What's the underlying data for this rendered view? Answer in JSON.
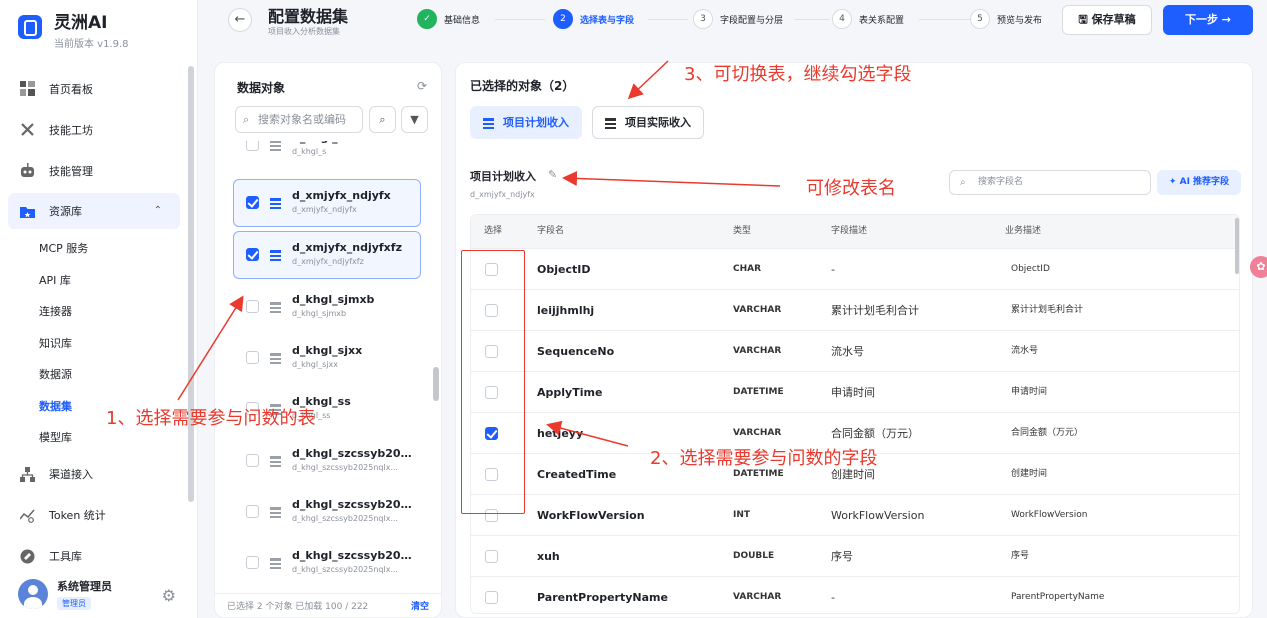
{
  "brand": {
    "name": "灵洲AI",
    "version": "当前版本 v1.9.8"
  },
  "nav": {
    "items": [
      {
        "label": "首页看板",
        "icon": "dashboard-icon"
      },
      {
        "label": "技能工坊",
        "icon": "tools-icon"
      },
      {
        "label": "技能管理",
        "icon": "robot-icon"
      },
      {
        "label": "资源库",
        "icon": "folder-icon"
      },
      {
        "label": "渠道接入",
        "icon": "network-icon"
      },
      {
        "label": "Token 统计",
        "icon": "chart-icon"
      },
      {
        "label": "工具库",
        "icon": "toolbox-icon"
      }
    ],
    "sub_items": [
      "MCP 服务",
      "API 库",
      "连接器",
      "知识库",
      "数据源",
      "数据集",
      "模型库"
    ]
  },
  "user": {
    "name": "系统管理员",
    "role": "管理员"
  },
  "header": {
    "back_icon": "←",
    "title": "配置数据集",
    "subtitle": "项目收入分析数据集"
  },
  "steps": [
    {
      "num": "1",
      "label": "基础信息"
    },
    {
      "num": "2",
      "label": "选择表与字段"
    },
    {
      "num": "3",
      "label": "字段配置与分层"
    },
    {
      "num": "4",
      "label": "表关系配置"
    },
    {
      "num": "5",
      "label": "预览与发布"
    }
  ],
  "actions": {
    "save_draft": "保存草稿",
    "next": "下一步 →"
  },
  "objects": {
    "title": "数据对象",
    "search_placeholder": "搜索对象名或编码",
    "items": [
      {
        "name": "d_khgl_s",
        "code": "d_khgl_s",
        "checked": false
      },
      {
        "name": "d_xmjyfx_ndjyfx",
        "code": "d_xmjyfx_ndjyfx",
        "checked": true
      },
      {
        "name": "d_xmjyfx_ndjyfxfz",
        "code": "d_xmjyfx_ndjyfxfz",
        "checked": true
      },
      {
        "name": "d_khgl_sjmxb",
        "code": "d_khgl_sjmxb",
        "checked": false
      },
      {
        "name": "d_khgl_sjxx",
        "code": "d_khgl_sjxx",
        "checked": false
      },
      {
        "name": "d_khgl_ss",
        "code": "d_khgl_ss",
        "checked": false
      },
      {
        "name": "d_khgl_szcssyb2025...",
        "code": "d_khgl_szcssyb2025nqlx...",
        "checked": false
      },
      {
        "name": "d_khgl_szcssyb2025...",
        "code": "d_khgl_szcssyb2025nqlx...",
        "checked": false
      },
      {
        "name": "d_khgl_szcssyb2025...",
        "code": "d_khgl_szcssyb2025nqlx...",
        "checked": false
      }
    ],
    "footer": "已选择 2 个对象  已加载 100 / 222",
    "clear": "清空"
  },
  "selected": {
    "title": "已选择的对象（2）",
    "tabs": [
      "项目计划收入",
      "项目实际收入"
    ],
    "table_name": "项目计划收入",
    "table_code": "d_xmjyfx_ndjyfx",
    "field_search_placeholder": "搜索字段名",
    "ai_button": "AI 推荐字段",
    "columns": [
      "选择",
      "字段名",
      "类型",
      "字段描述",
      "业务描述"
    ],
    "rows": [
      {
        "name": "ObjectID",
        "type": "CHAR",
        "desc": "-",
        "biz": "ObjectID",
        "checked": false
      },
      {
        "name": "leijjhmlhj",
        "type": "VARCHAR",
        "desc": "累计计划毛利合计",
        "biz": "累计计划毛利合计",
        "checked": false
      },
      {
        "name": "SequenceNo",
        "type": "VARCHAR",
        "desc": "流水号",
        "biz": "流水号",
        "checked": false
      },
      {
        "name": "ApplyTime",
        "type": "DATETIME",
        "desc": "申请时间",
        "biz": "申请时间",
        "checked": false
      },
      {
        "name": "hetjeyy",
        "type": "VARCHAR",
        "desc": "合同金额（万元）",
        "biz": "合同金额（万元）",
        "checked": true
      },
      {
        "name": "CreatedTime",
        "type": "DATETIME",
        "desc": "创建时间",
        "biz": "创建时间",
        "checked": false
      },
      {
        "name": "WorkFlowVersion",
        "type": "INT",
        "desc": "WorkFlowVersion",
        "biz": "WorkFlowVersion",
        "checked": false
      },
      {
        "name": "xuh",
        "type": "DOUBLE",
        "desc": "序号",
        "biz": "序号",
        "checked": false
      },
      {
        "name": "ParentPropertyName",
        "type": "VARCHAR",
        "desc": "-",
        "biz": "ParentPropertyName",
        "checked": false
      }
    ]
  },
  "annotations": {
    "a1": "1、选择需要参与问数的表",
    "a2": "2、选择需要参与问数的字段",
    "a3": "3、可切换表，继续勾选字段",
    "a4": "可修改表名"
  },
  "colors": {
    "accent": "#1e5eff",
    "annotation": "#ea3a2e",
    "done": "#22b35e"
  }
}
